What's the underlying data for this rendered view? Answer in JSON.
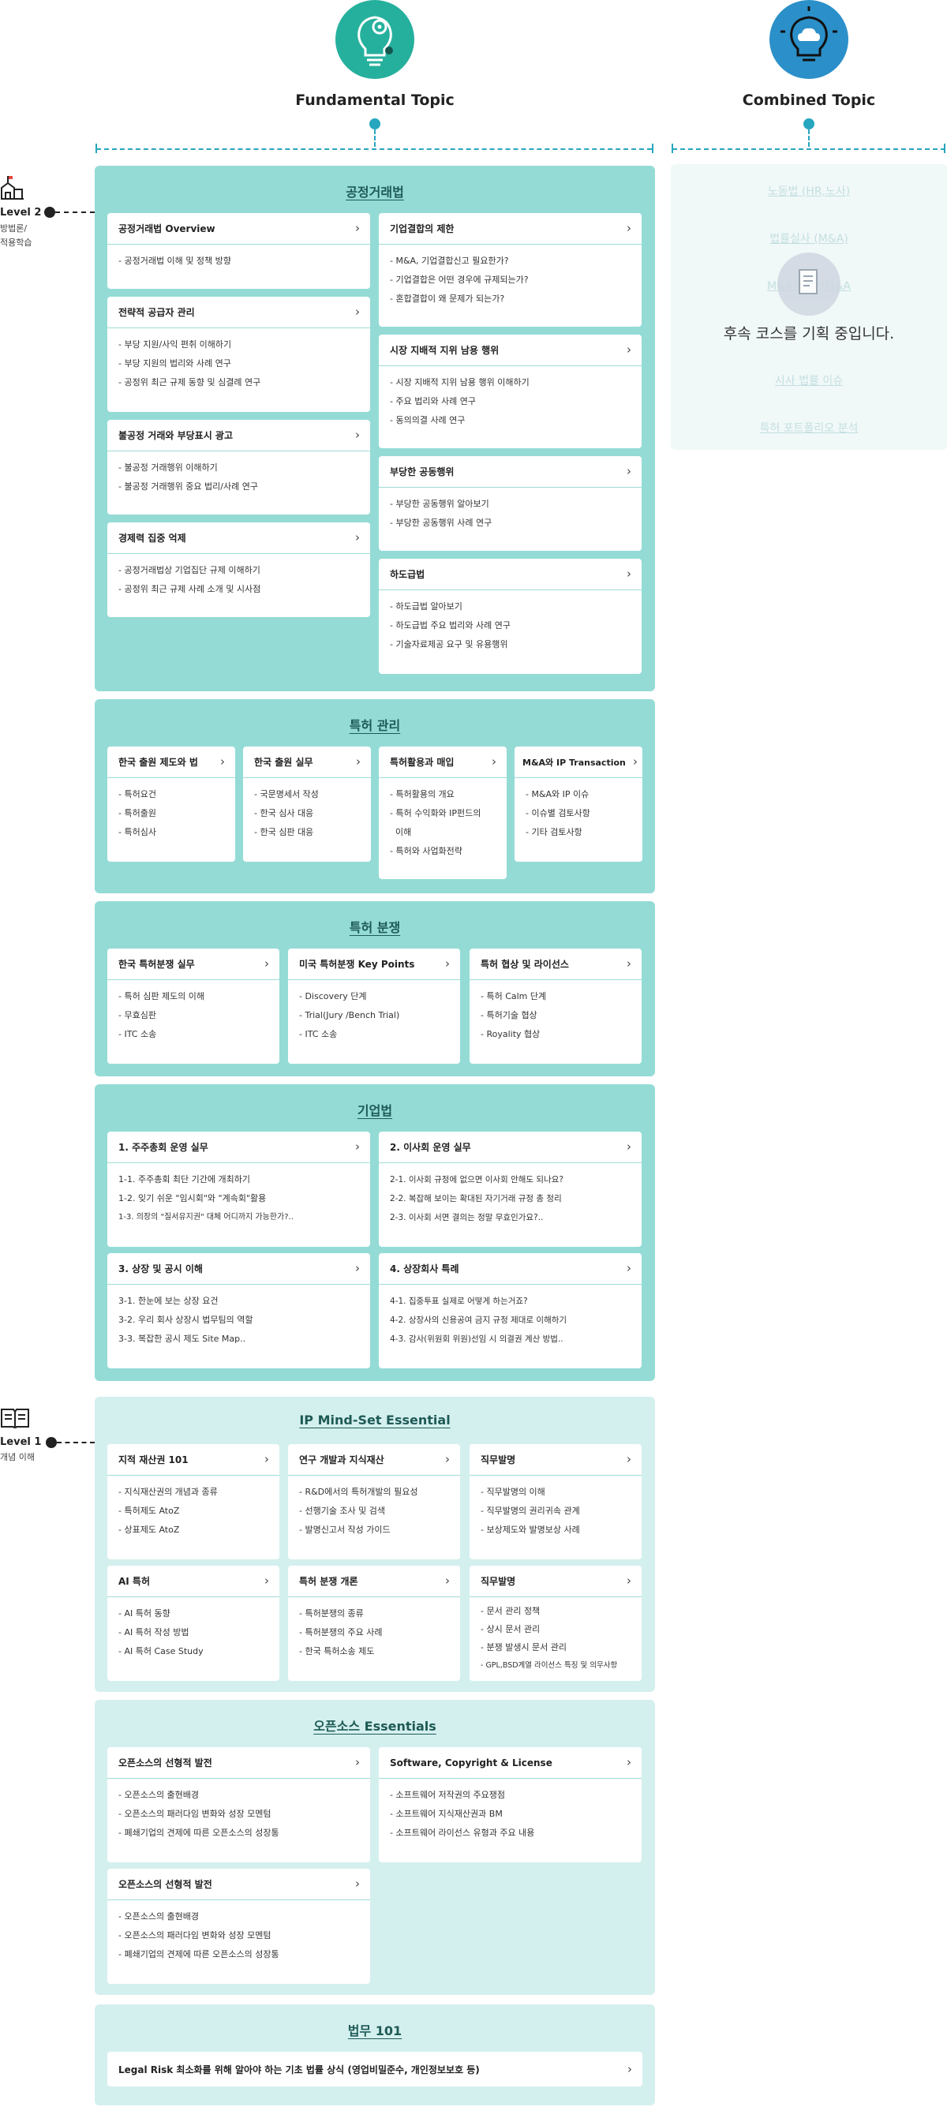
{
  "header": {
    "fundamental_label": "Fundamental Topic",
    "combined_label": "Combined Topic",
    "fundamental_icon": "lightbulb-gear-icon",
    "combined_icon": "lightbulb-cloud-icon",
    "fundamental_color": "#25b09d",
    "combined_color": "#2b90c9"
  },
  "levels": [
    {
      "label": "Level 2",
      "sub1": "방법론/",
      "sub2": "적용학습",
      "icon": "building-icon"
    },
    {
      "label": "Level 1",
      "sub1": "개념 이해",
      "icon": "book-icon"
    }
  ],
  "combined": {
    "items": [
      "노동법 (HR,노사)",
      "법률실사 (M&A)",
      "M&A와 (IP)M&A",
      "시사 법률 이슈",
      "특허 포트폴리오 분석"
    ],
    "message": "후속 코스를 기획 중입니다.",
    "icon": "document-icon"
  },
  "sections": [
    {
      "title": "공정거래법",
      "cards": [
        {
          "title": "공정거래법 Overview",
          "items": [
            "- 공정거래법 이해 및 정책 방향"
          ]
        },
        {
          "title": "전략적 공급자 관리",
          "items": [
            "- 부당 지원/사익 편취 이해하기",
            "- 부당 지원의 법리와 사례 연구",
            "- 공정위 최근 규제 동향 및 심결례 연구"
          ]
        },
        {
          "title": "불공정 거래와 부당표시 광고",
          "items": [
            "- 불공정 거래행위 이해하기",
            "- 불공정 거래행위 중요 법리/사례 연구"
          ]
        },
        {
          "title": "경제력 집중 억제",
          "items": [
            "- 공정거래법상 기업집단 규제 이해하기",
            "- 공정위 최근 규제 사례 소개 및 시사점"
          ]
        },
        {
          "title": "기업결합의 제한",
          "items": [
            "- M&A, 기업결합신고 필요한가?",
            "- 기업결합은 어떤 경우에 규제되는가?",
            "- 혼합결합이 왜 문제가 되는가?"
          ]
        },
        {
          "title": "시장 지배적 지위 남용 행위",
          "items": [
            "- 시장 지배적 지위 남용 행위 이해하기",
            "- 주요 법리와 사례 연구",
            "- 동의의결 사례 연구"
          ]
        },
        {
          "title": "부당한 공동행위",
          "items": [
            "- 부당한 공동행위 알아보기",
            "- 부당한 공동행위 사례 연구"
          ]
        },
        {
          "title": "하도급법",
          "items": [
            "- 하도급법 알아보기",
            "- 하도급법 주요 법리와 사례 연구",
            "- 기술자료제공 요구 및 유용행위"
          ]
        }
      ]
    },
    {
      "title": "특허 관리",
      "cards": [
        {
          "title": "한국 출원 제도와 법",
          "items": [
            "- 특허요건",
            "- 특허출원",
            "- 특허심사"
          ]
        },
        {
          "title": "한국 출원 실무",
          "items": [
            "- 국문명세서 작성",
            "- 한국 심사 대응",
            "- 한국 심판 대응"
          ]
        },
        {
          "title": "특허활용과 매입",
          "items": [
            "- 특허활용의 개요",
            "- 특허 수익화와 IP펀드의",
            "  이해",
            "- 특허와 사업화전략"
          ]
        },
        {
          "title": "M&A와 IP Transaction",
          "items": [
            "- M&A와 IP 이슈",
            "- 이슈별 검토사항",
            "- 기타 검토사항"
          ]
        }
      ]
    },
    {
      "title": "특허 분쟁",
      "cards": [
        {
          "title": "한국 특허분쟁 실무",
          "items": [
            "- 특허 심판 제도의 이해",
            "- 무효심판",
            "- ITC 소송"
          ]
        },
        {
          "title": "미국 특허분쟁 Key Points",
          "items": [
            "- Discovery 단계",
            "- Trial(Jury /Bench Trial)",
            "- ITC 소송"
          ]
        },
        {
          "title": "특허 협상 및 라이선스",
          "items": [
            "- 특허 Calm 단계",
            "- 특허기술 협상",
            "- Royality 협상"
          ]
        }
      ]
    },
    {
      "title": "기업법",
      "cards": [
        {
          "title": "1. 주주총회 운영 실무",
          "items": [
            "1-1. 주주총회 최단 기간에 개최하기",
            "1-2. 잊기 쉬운 \"임시회\"와 \"계속회\"활용",
            "1-3. 의장의 \"질서유지권\" 대체 어디까지 가능한가?.."
          ]
        },
        {
          "title": "2. 이사회 운영 실무",
          "items": [
            "2-1. 이사회 규정에 없으면 이사회 안해도 되나요?",
            "2-2. 복잡해 보이는 확대된 자기거래 규정 총 정리",
            "2-3. 이사회 서면 결의는 정말 무효인가요?.."
          ]
        },
        {
          "title": "3. 상장 및 공시 이해",
          "items": [
            "3-1. 한눈에 보는 상장 요건",
            "3-2. 우리 회사 상장시 법무팀의 역할",
            "3-3. 복잡한 공시 제도 Site Map.."
          ]
        },
        {
          "title": "4. 상장회사 특례",
          "items": [
            "4-1. 집중투표 실제로 어떻게 하는거죠?",
            "4-2. 상장사의 신용공여 금지 규정 제대로 이해하기",
            "4-3. 감사(위원회 위원)선임 시 의결권 계산 방법.."
          ]
        }
      ]
    },
    {
      "title": "IP Mind-Set Essential",
      "cards": [
        {
          "title": "지적 재산권 101",
          "items": [
            "- 지식재산권의 개념과 종류",
            "- 특허제도 AtoZ",
            "- 상표제도 AtoZ"
          ]
        },
        {
          "title": "연구 개발과 지식재산",
          "items": [
            "- R&D에서의 특허개발의 필요성",
            "- 선행기술 조사 및 검색",
            "- 발명신고서 작성 가이드"
          ]
        },
        {
          "title": "직무발명",
          "items": [
            "- 직무발명의 이해",
            "- 직무발명의 권리귀속 관계",
            "- 보상제도와 발명보상 사례"
          ]
        },
        {
          "title": "AI 특허",
          "items": [
            "- AI 특허 동향",
            "- AI 특허 작성 방법",
            "- AI 특허 Case Study"
          ]
        },
        {
          "title": "특허 분쟁 개론",
          "items": [
            "- 특허분쟁의 종류",
            "- 특허분쟁의 주요 사례",
            "- 한국 특허소송 제도"
          ]
        },
        {
          "title": "직무발명",
          "items": [
            "- 문서 관리 정책",
            "- 상시 문서 관리",
            "- 분쟁 발생시 문서 관리",
            "- GPL,BSD계열 라이선스 특징 및 의무사항"
          ]
        }
      ]
    },
    {
      "title": "오픈소스 Essentials",
      "cards": [
        {
          "title": "오픈소스의 선형적 발전",
          "items": [
            "- 오픈소스의 출현배경",
            "- 오픈소스의 패러다임 변화와 성장 모멘텀",
            "- 폐쇄기업의 견제에 따른 오픈소스의 성장통"
          ]
        },
        {
          "title": "Software, Copyright & License",
          "items": [
            "- 소프트웨어 저작권의 주요쟁점",
            "- 소프트웨어 지식재산권과 BM",
            "- 소프트웨어 라이선스 유형과 주요 내용"
          ]
        },
        {
          "title": "오픈소스의 선형적 발전",
          "items": [
            "- 오픈소스의 출현배경",
            "- 오픈소스의 패러다임 변화와 성장 모멘텀",
            "- 폐쇄기업의 견제에 따른 오픈소스의 성장통"
          ]
        }
      ]
    },
    {
      "title": "법무 101",
      "cards": [
        {
          "title": "Legal Risk 최소화를 위해 알아야 하는 기초 법률 상식 (영업비밀준수, 개인정보보호 등)",
          "items": []
        }
      ]
    }
  ]
}
